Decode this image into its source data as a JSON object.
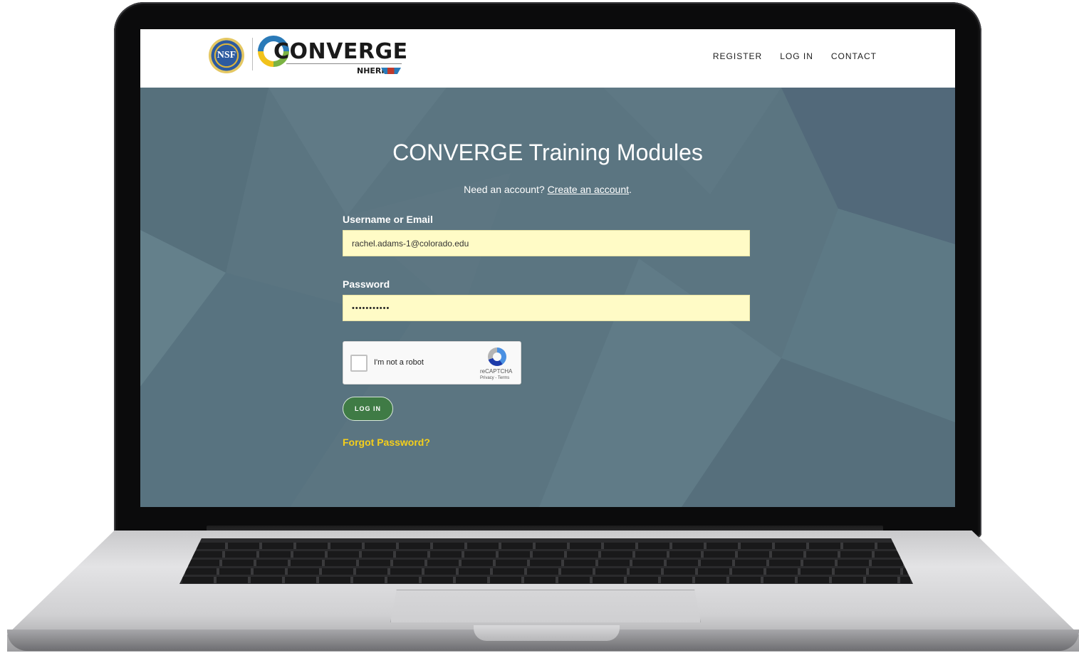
{
  "header": {
    "nsf_seal_text": "NSF",
    "logo_word": "CONVERGE",
    "logo_sub": "NHERI",
    "nav": [
      {
        "label": "REGISTER"
      },
      {
        "label": "LOG IN"
      },
      {
        "label": "CONTACT"
      }
    ]
  },
  "login": {
    "title": "CONVERGE Training Modules",
    "need_account_text": "Need an account?",
    "create_account_link": "Create an account",
    "create_account_suffix": ".",
    "username_label": "Username or Email",
    "username_value": "rachel.adams-1@colorado.edu",
    "password_label": "Password",
    "password_value": "•••••••••••",
    "submit_label": "LOG IN",
    "forgot_link": "Forgot Password?"
  },
  "recaptcha": {
    "checkbox_label": "I'm not a robot",
    "brand": "reCAPTCHA",
    "terms": "Privacy - Terms"
  },
  "colors": {
    "hero_background": "#5b7581",
    "button_green": "#3f7b45",
    "link_yellow": "#f5cf1b",
    "autofill_yellow": "#fffbc6"
  }
}
